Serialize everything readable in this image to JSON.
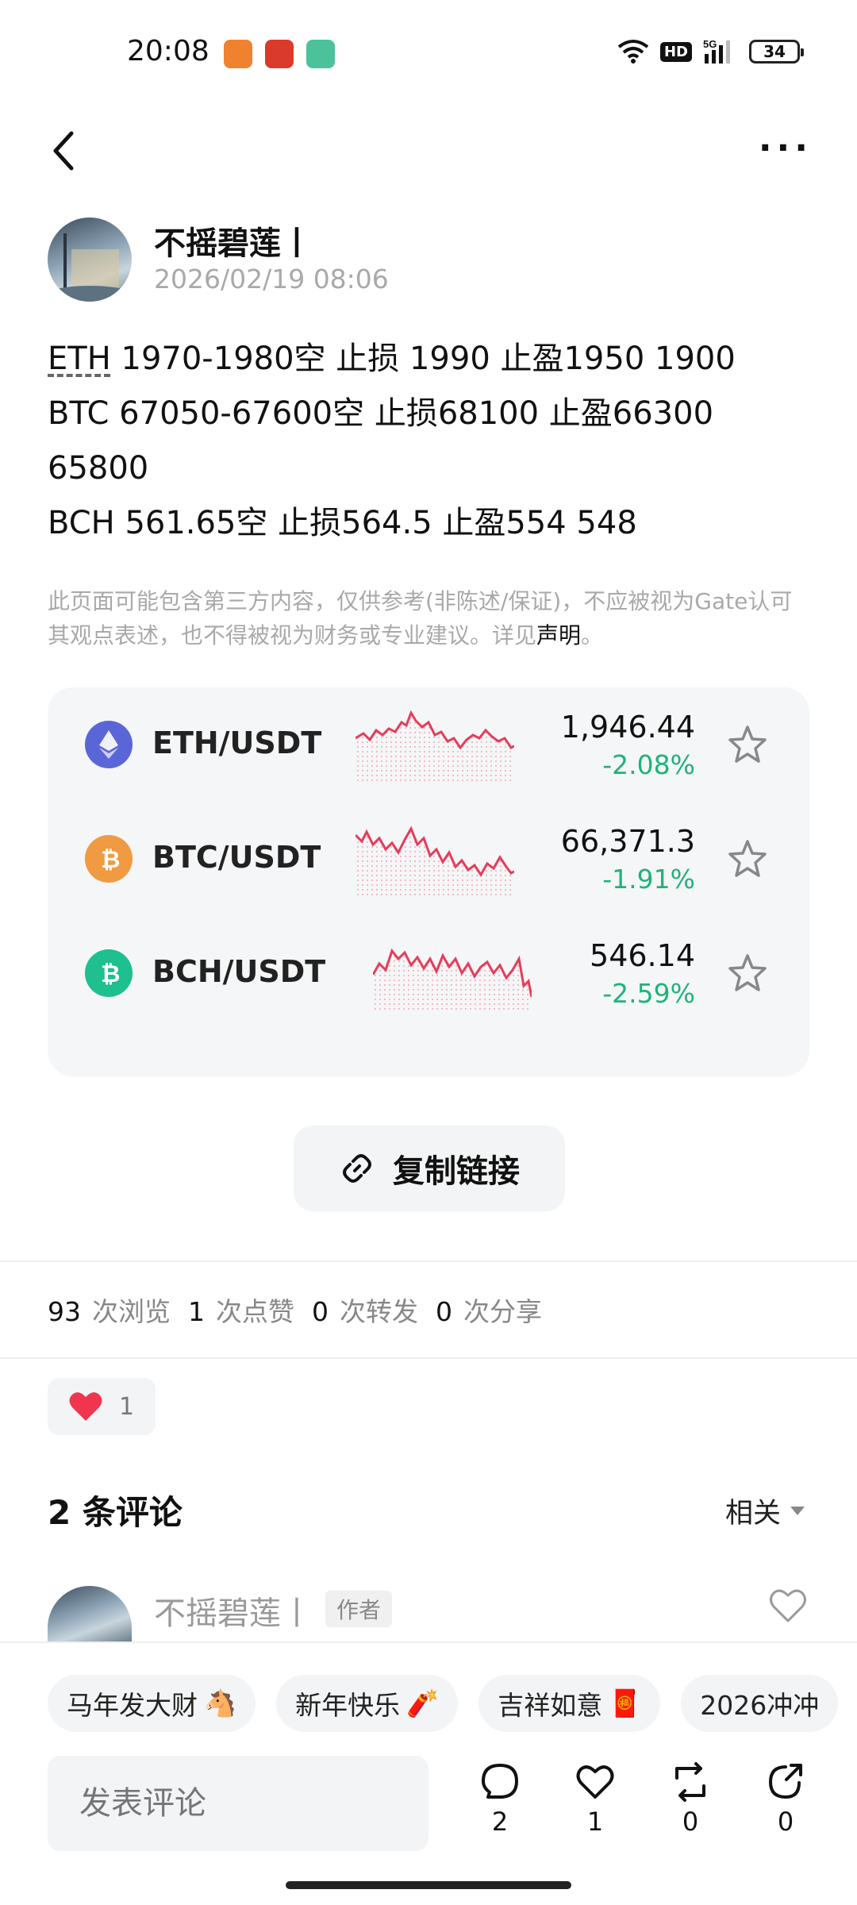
{
  "status_bar": {
    "time": "20:08",
    "network": "5G",
    "hd": "HD",
    "battery": "34"
  },
  "author": {
    "name": "不摇碧莲丨",
    "date": "2026/02/19 08:06"
  },
  "post": {
    "line1_prefix": "ETH",
    "line1_rest": " 1970-1980空 止损 1990 止盈1950 1900",
    "line2": "BTC 67050-67600空 止损68100 止盈66300 65800",
    "line3": "BCH 561.65空 止损564.5 止盈554 548"
  },
  "disclaimer": {
    "text": "此页面可能包含第三方内容，仅供参考(非陈述/保证)，不应被视为Gate认可其观点表述，也不得被视为财务或专业建议。详见",
    "link": "声明",
    "tail": "。"
  },
  "markets": [
    {
      "pair": "ETH/USDT",
      "price": "1,946.44",
      "change": "-2.08%",
      "icon": "eth-icon",
      "color": "#5a66d8"
    },
    {
      "pair": "BTC/USDT",
      "price": "66,371.3",
      "change": "-1.91%",
      "icon": "btc-icon",
      "color": "#f09a41"
    },
    {
      "pair": "BCH/USDT",
      "price": "546.14",
      "change": "-2.59%",
      "icon": "bch-icon",
      "color": "#1fbf8f"
    }
  ],
  "copy_link": {
    "label": "复制链接"
  },
  "stats": [
    {
      "num": "93",
      "label": "次浏览"
    },
    {
      "num": "1",
      "label": "次点赞"
    },
    {
      "num": "0",
      "label": "次转发"
    },
    {
      "num": "0",
      "label": "次分享"
    }
  ],
  "reaction": {
    "count": "1"
  },
  "comments": {
    "title": "2 条评论",
    "sort": "相关",
    "first": {
      "name": "不摇碧莲丨",
      "tag": "作者"
    }
  },
  "chips": [
    {
      "label": "马年发大财",
      "emoji": "🐴"
    },
    {
      "label": "新年快乐",
      "emoji": "🧨"
    },
    {
      "label": "吉祥如意",
      "emoji": "🧧"
    },
    {
      "label": "2026冲冲",
      "emoji": ""
    }
  ],
  "bottom": {
    "placeholder": "发表评论",
    "comments_count": "2",
    "likes_count": "1",
    "reposts_count": "0",
    "shares_count": "0"
  }
}
